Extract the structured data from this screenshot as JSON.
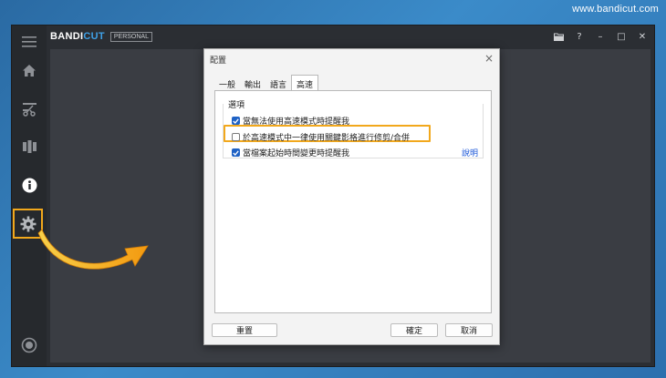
{
  "watermark": "www.bandicut.com",
  "app": {
    "brand_main": "BANDI",
    "brand_accent": "CUT",
    "edition": "PERSONAL",
    "controls": {
      "folder": "folder-icon",
      "help": "?",
      "minimize": "–",
      "maximize": "□",
      "close": "✕"
    },
    "sidebar": [
      {
        "name": "home-icon"
      },
      {
        "name": "cut-icon"
      },
      {
        "name": "join-icon"
      },
      {
        "name": "info-icon"
      },
      {
        "name": "gear-icon",
        "highlighted": true
      },
      {
        "name": "record-icon"
      }
    ]
  },
  "dialog": {
    "title": "配置",
    "close": "×",
    "tabs": [
      {
        "label": "一般",
        "active": false
      },
      {
        "label": "輸出",
        "active": false
      },
      {
        "label": "語言",
        "active": false
      },
      {
        "label": "高速",
        "active": true
      }
    ],
    "group_label": "選項",
    "options": [
      {
        "label": "當無法使用高速模式時提醒我",
        "checked": true
      },
      {
        "label": "於高速模式中一律使用關鍵影格進行修剪/合併",
        "checked": false,
        "highlighted": true
      },
      {
        "label": "當檔案起始時間變更時提醒我",
        "checked": true
      }
    ],
    "help_link": "說明",
    "buttons": {
      "reset": "重置",
      "ok": "確定",
      "cancel": "取消"
    }
  },
  "colors": {
    "highlight": "#f2a81c",
    "checkbox": "#1f62c5",
    "link": "#1a56d8"
  }
}
